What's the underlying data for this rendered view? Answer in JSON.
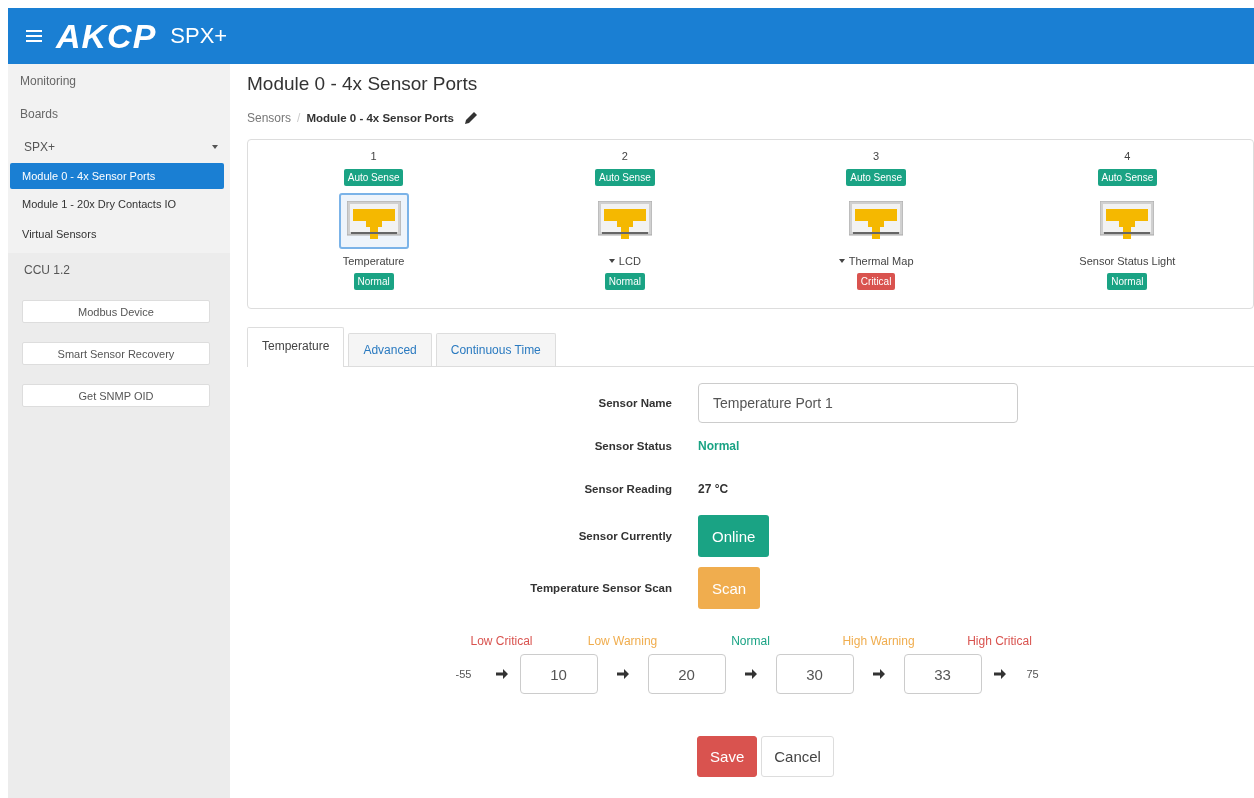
{
  "header": {
    "logo": "AKCP",
    "product": "SPX+"
  },
  "sidebar": {
    "items": [
      {
        "label": "Monitoring",
        "kind": "heading",
        "selected": false
      },
      {
        "label": "Boards",
        "kind": "heading",
        "selected": false
      },
      {
        "label": "SPX+",
        "kind": "dropdown",
        "selected": false
      },
      {
        "label": "Module 0 - 4x Sensor Ports",
        "kind": "module",
        "selected": true
      },
      {
        "label": "Module 1 - 20x Dry Contacts IO",
        "kind": "module",
        "selected": false
      },
      {
        "label": "Virtual Sensors",
        "kind": "module",
        "selected": false
      },
      {
        "label": "CCU 1.2",
        "kind": "group",
        "selected": false
      }
    ],
    "buttons": [
      "Modbus Device",
      "Smart Sensor Recovery",
      "Get SNMP OID"
    ]
  },
  "page": {
    "title": "Module 0 - 4x Sensor Ports",
    "separator": "/",
    "breadcrumb": [
      {
        "label": "Sensors",
        "kind": "link"
      },
      {
        "label": "Module 0 - 4x Sensor Ports",
        "kind": "current"
      }
    ]
  },
  "ports": [
    {
      "number": "1",
      "mode": "Auto Sense",
      "name": "Temperature",
      "expandable": false,
      "status": "Normal",
      "critical": false,
      "selected": true
    },
    {
      "number": "2",
      "mode": "Auto Sense",
      "name": "LCD",
      "expandable": true,
      "status": "Normal",
      "critical": false,
      "selected": false
    },
    {
      "number": "3",
      "mode": "Auto Sense",
      "name": "Thermal Map",
      "expandable": true,
      "status": "Critical",
      "critical": true,
      "selected": false
    },
    {
      "number": "4",
      "mode": "Auto Sense",
      "name": "Sensor Status Light",
      "expandable": false,
      "status": "Normal",
      "critical": false,
      "selected": false
    }
  ],
  "tabs": [
    {
      "label": "Temperature",
      "selected": true
    },
    {
      "label": "Advanced",
      "selected": false
    },
    {
      "label": "Continuous Time",
      "selected": false
    }
  ],
  "form": {
    "rows": [
      {
        "label": "Sensor Name",
        "kind": "input",
        "value": "Temperature Port 1"
      },
      {
        "label": "Sensor Status",
        "kind": "status",
        "value": "Normal"
      },
      {
        "label": "Sensor Reading",
        "kind": "text",
        "value": "27 °C"
      },
      {
        "label": "Sensor Currently",
        "kind": "toggle",
        "value": "Online"
      },
      {
        "label": "Temperature Sensor Scan",
        "kind": "action",
        "value": "Scan"
      }
    ]
  },
  "thresholds": {
    "min": "-55",
    "max": "75",
    "levels": [
      {
        "label": "Low Critical",
        "kind": "critical"
      },
      {
        "label": "Low Warning",
        "kind": "warning"
      },
      {
        "label": "Normal",
        "kind": "normal"
      },
      {
        "label": "High Warning",
        "kind": "warning"
      },
      {
        "label": "High Critical",
        "kind": "critical"
      }
    ],
    "values": [
      "10",
      "20",
      "30",
      "33"
    ]
  },
  "actions": [
    {
      "label": "Save",
      "kind": "primary"
    },
    {
      "label": "Cancel",
      "kind": "default"
    }
  ]
}
